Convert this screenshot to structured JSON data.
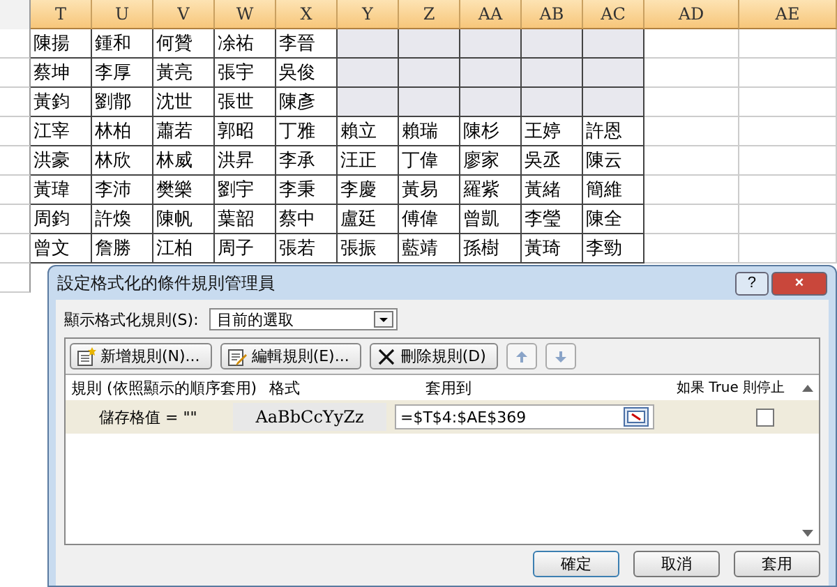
{
  "sheet": {
    "columns": [
      "T",
      "U",
      "V",
      "W",
      "X",
      "Y",
      "Z",
      "AA",
      "AB",
      "AC",
      "AD",
      "AE"
    ],
    "rows": [
      [
        "陳揚",
        "鍾和",
        "何贊",
        "凃祐",
        "李晉"
      ],
      [
        "蔡坤",
        "李厚",
        "黃亮",
        "張宇",
        "吳俊"
      ],
      [
        "黃鈞",
        "劉鄁",
        "沈世",
        "張世",
        "陳彥"
      ],
      [
        "江宰",
        "林柏",
        "蕭若",
        "郭昭",
        "丁雅",
        "賴立",
        "賴瑞",
        "陳杉",
        "王婷",
        "許恩"
      ],
      [
        "洪豪",
        "林欣",
        "林威",
        "洪昇",
        "李承",
        "汪正",
        "丁偉",
        "廖家",
        "吳丞",
        "陳云"
      ],
      [
        "黃瑋",
        "李沛",
        "樊樂",
        "劉宇",
        "李秉",
        "李慶",
        "黃易",
        "羅紫",
        "黃緒",
        "簡維"
      ],
      [
        "周鈞",
        "許煥",
        "陳帆",
        "葉韶",
        "蔡中",
        "盧廷",
        "傅偉",
        "曾凱",
        "李瑩",
        "陳全"
      ],
      [
        "曾文",
        "詹勝",
        "江柏",
        "周子",
        "張若",
        "張振",
        "藍靖",
        "孫樹",
        "黃琦",
        "李勁"
      ]
    ]
  },
  "dialog": {
    "title": "設定格式化的條件規則管理員",
    "help": "?",
    "close": "×",
    "show_label": "顯示格式化規則(S):",
    "show_value": "目前的選取",
    "toolbar": [
      {
        "kind": "new",
        "label": "新增規則(N)..."
      },
      {
        "kind": "edit",
        "label": "編輯規則(E)..."
      },
      {
        "kind": "delete",
        "label": "刪除規則(D)"
      },
      {
        "kind": "up"
      },
      {
        "kind": "down"
      }
    ],
    "columns": [
      "規則 (依照顯示的順序套用)",
      "格式",
      "套用到",
      "如果 True 則停止"
    ],
    "rules": [
      {
        "rule": "儲存格值 = \"\"",
        "preview": "AaBbCcYyZz",
        "applies_to": "=$T$4:$AE$369",
        "stop_if_true": false,
        "selected": true
      }
    ],
    "buttons": [
      "確定",
      "取消",
      "套用"
    ]
  }
}
